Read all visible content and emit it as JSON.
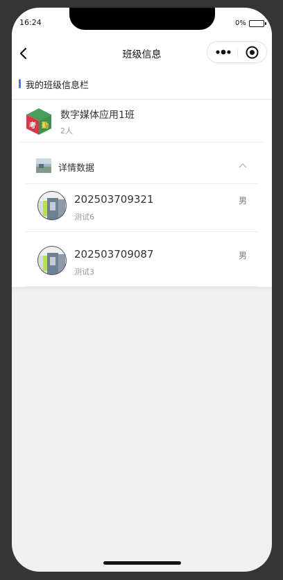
{
  "status_bar": {
    "time": "16:24",
    "battery": "0%"
  },
  "nav": {
    "title": "班级信息"
  },
  "section": {
    "title": "我的班级信息栏"
  },
  "class_card": {
    "name": "数字媒体应用1班",
    "count": "2人",
    "logo_text_1": "考",
    "logo_text_2": "勤"
  },
  "detail": {
    "label": "详情数据"
  },
  "students": [
    {
      "id": "202503709321",
      "name": "测试6",
      "gender": "男"
    },
    {
      "id": "202503709087",
      "name": "测试3",
      "gender": "男"
    }
  ],
  "colors": {
    "accent": "#3b7cf0",
    "background": "#f0f0f0"
  }
}
